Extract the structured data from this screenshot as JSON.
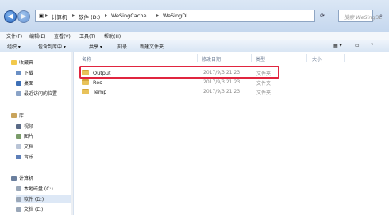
{
  "address": {
    "segments": [
      "计算机",
      "软件 (D:)",
      "WeSingCache",
      "WeSingDL"
    ],
    "separator": "▸"
  },
  "search": {
    "placeholder": "搜索 WeSingDL"
  },
  "menu": [
    "文件(F)",
    "编辑(E)",
    "查看(V)",
    "工具(T)",
    "帮助(H)"
  ],
  "toolbar": {
    "organize": "组织 ▾",
    "include": "包含到库中 ▾",
    "share": "共享 ▾",
    "burn": "刻录",
    "new_folder": "新建文件夹"
  },
  "sidebar": {
    "favorites": {
      "label": "收藏夹",
      "items": [
        "下载",
        "桌面",
        "最近访问的位置"
      ]
    },
    "library": {
      "label": "库",
      "items": [
        "视频",
        "图片",
        "文档",
        "音乐"
      ]
    },
    "computer": {
      "label": "计算机",
      "items": [
        "本地磁盘 (C:)",
        "软件 (D:)",
        "文档 (E:)"
      ]
    }
  },
  "columns": {
    "name": "名称",
    "date": "修改日期",
    "type": "类型",
    "size": "大小"
  },
  "files": [
    {
      "name": "Output",
      "date": "2017/9/3 21:23",
      "type": "文件夹"
    },
    {
      "name": "Res",
      "date": "2017/9/3 21:23",
      "type": "文件夹"
    },
    {
      "name": "Temp",
      "date": "2017/9/3 21:23",
      "type": "文件夹"
    }
  ],
  "colors": {
    "highlight": "#e0253f",
    "folder": "#e8c25a"
  }
}
